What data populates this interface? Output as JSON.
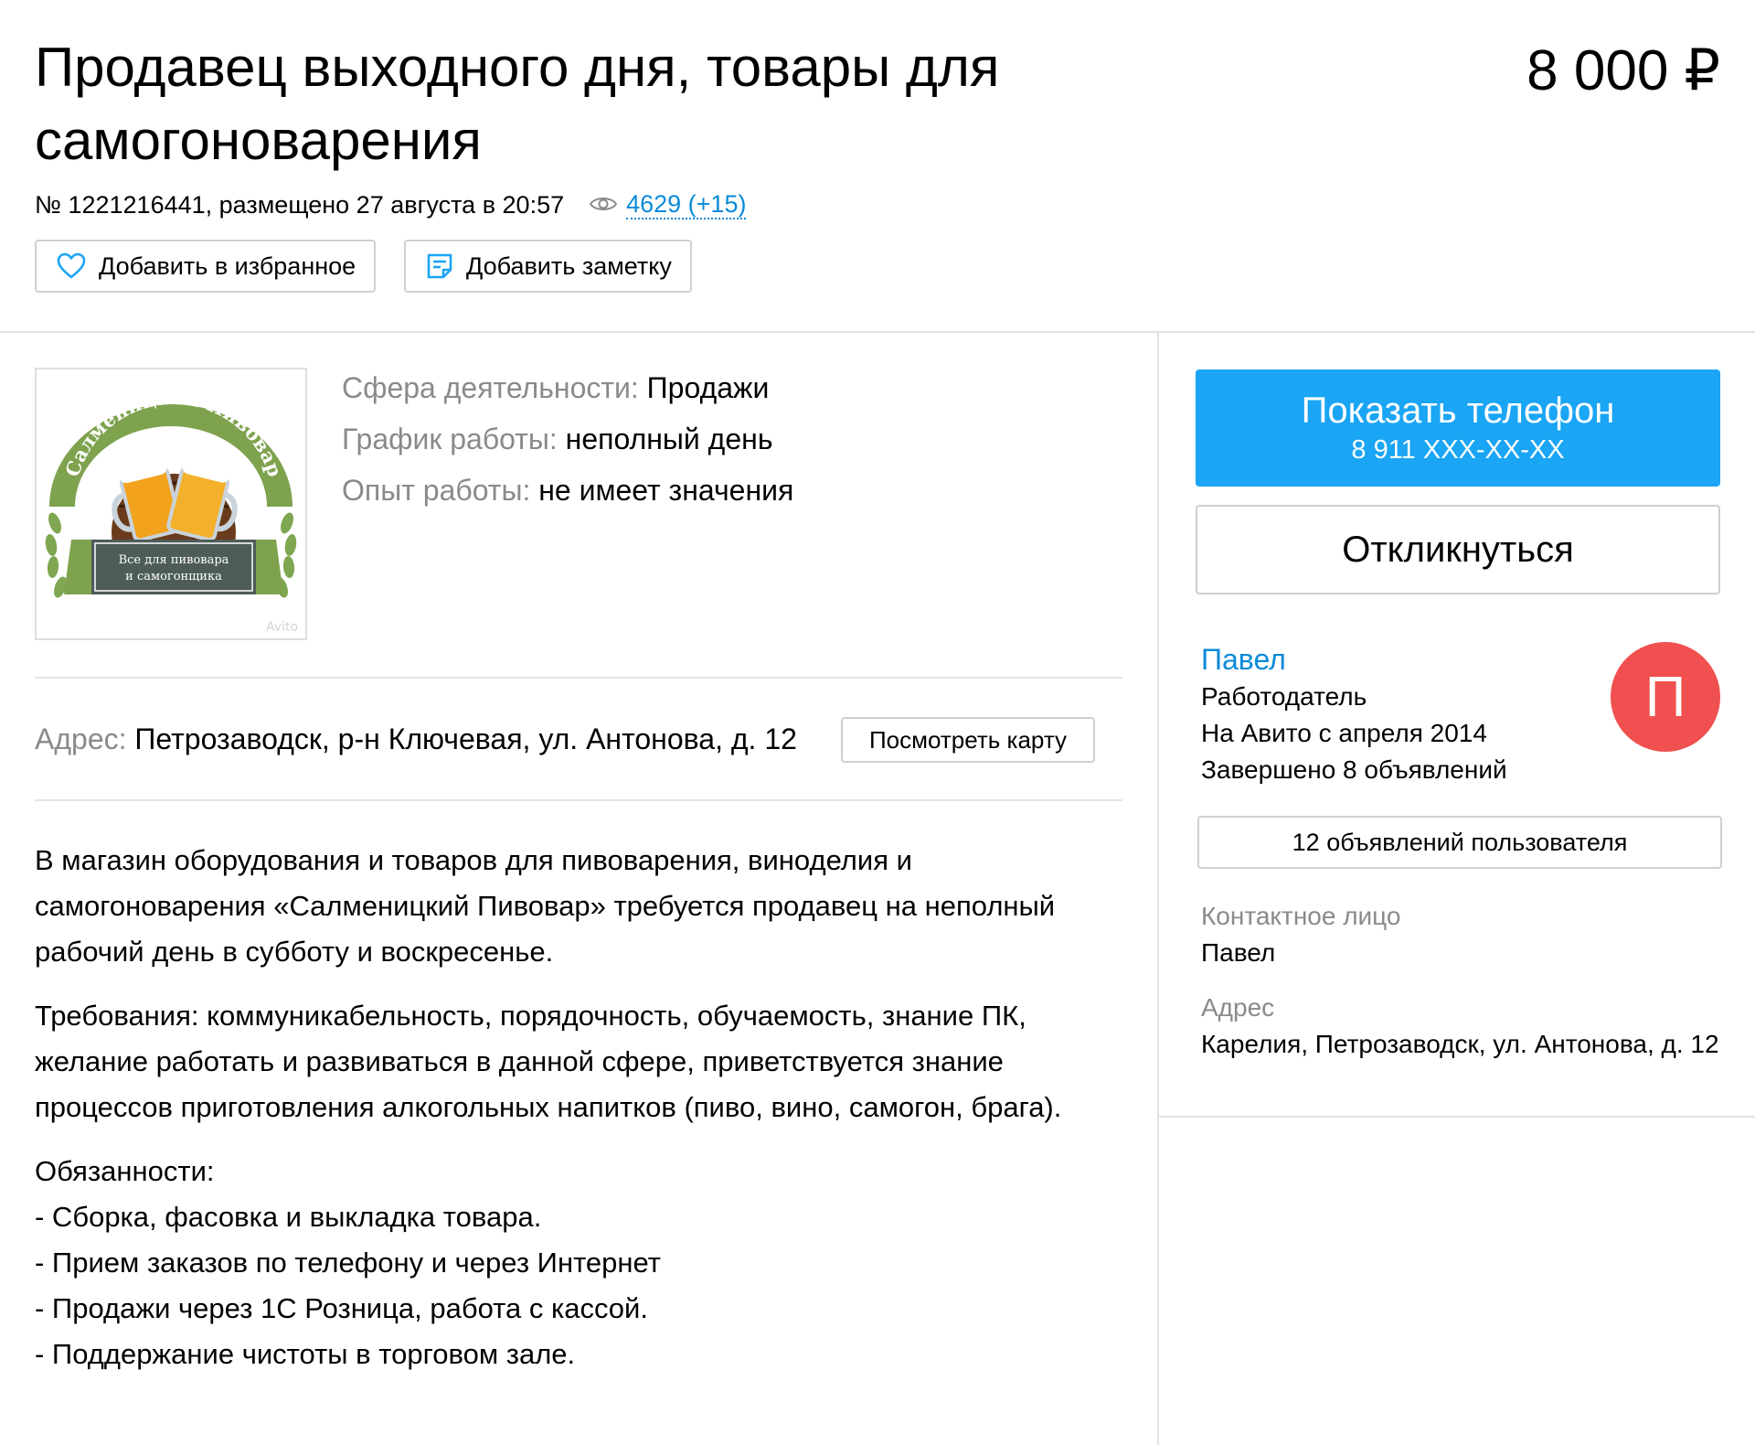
{
  "header": {
    "title": "Продавец выходного дня, товары для самогоноварения",
    "price": "8 000 ₽",
    "listing_info": "№ 1221216441, размещено 27 августа в 20:57",
    "views": "4629 (+15)",
    "favorite_label": "Добавить в избранное",
    "note_label": "Добавить заметку"
  },
  "logo": {
    "arc_text": "Салменицкий Пивовар",
    "banner_line1": "Все для пивовара",
    "banner_line2": "и самогонщика",
    "watermark": "Avito"
  },
  "params": [
    {
      "key": "Сфера деятельности:",
      "value": "Продажи"
    },
    {
      "key": "График работы:",
      "value": "неполный день"
    },
    {
      "key": "Опыт работы:",
      "value": "не имеет значения"
    }
  ],
  "address": {
    "key": "Адрес:",
    "value": "Петрозаводск, р-н Ключевая, ул. Антонова, д. 12",
    "map_button": "Посмотреть карту"
  },
  "description": {
    "intro_lines": [
      "В магазин оборудования и товаров для пивоварения, виноделия и",
      "самогоноварения «Салменицкий Пивовар» требуется продавец на неполный",
      "рабочий день в субботу и воскресенье."
    ],
    "requirements_lines": [
      "Требования: коммуникабельность, порядочность, обучаемость, знание ПК,",
      "желание работать и развиваться в данной сфере, приветствуется знание",
      "процессов приготовления алкогольных напитков (пиво, вино, самогон, брага)."
    ],
    "duties_lines": [
      "Обязанности:",
      "- Сборка, фасовка и выкладка товара.",
      "- Прием заказов по телефону и через Интернет",
      "- Продажи через 1С Розница, работа с кассой.",
      "- Поддержание чистоты в торговом зале."
    ]
  },
  "sidebar": {
    "show_phone": "Показать телефон",
    "phone_masked": "8 911 XXX-XX-XX",
    "respond": "Откликнуться",
    "seller_name": "Павел",
    "seller_role": "Работодатель",
    "seller_since": "На Авито с апреля 2014",
    "seller_completed": "Завершено 8 объявлений",
    "avatar_letter": "П",
    "user_ads": "12 объявлений пользователя",
    "contact_label": "Контактное лицо",
    "contact_value": "Павел",
    "address_label": "Адрес",
    "address_value": "Карелия, Петрозаводск, ул. Антонова, д. 12"
  },
  "colors": {
    "accent_blue": "#1aa5f5",
    "link_blue": "#0a8ad8",
    "avatar_red": "#f0504f"
  }
}
